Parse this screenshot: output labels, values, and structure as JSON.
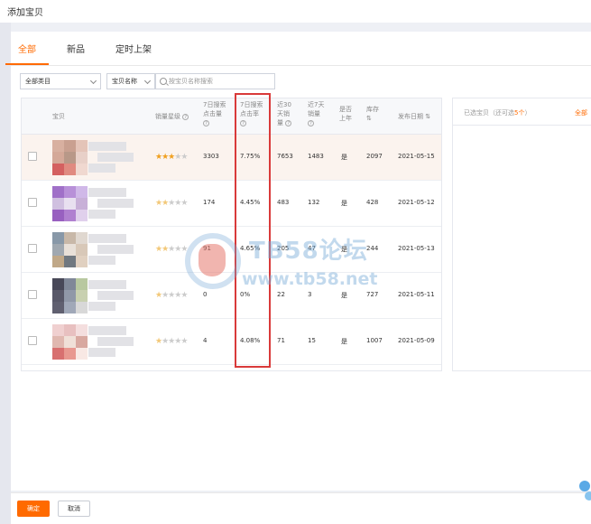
{
  "dialog": {
    "title": "添加宝贝"
  },
  "tabs": [
    {
      "label": "全部",
      "active": true
    },
    {
      "label": "新品",
      "active": false
    },
    {
      "label": "定时上架",
      "active": false
    }
  ],
  "filters": {
    "category_select": "全部类目",
    "field_select": "宝贝名称",
    "search_placeholder": "按宝贝名称搜索"
  },
  "table": {
    "headers": {
      "item": "宝贝",
      "star": "销量星级",
      "search_clicks": [
        "7日搜索",
        "点击量"
      ],
      "ctr": [
        "7日搜索",
        "点击率"
      ],
      "sales30": [
        "近30",
        "天销",
        "量"
      ],
      "sales7": [
        "近7天",
        "销量"
      ],
      "listed": [
        "是否",
        "上年"
      ],
      "stock": [
        "库存"
      ],
      "date": "发布日期"
    },
    "rows": [
      {
        "stars": 3,
        "search_clicks": "3303",
        "ctr": "7.75%",
        "sales30": "7653",
        "sales7": "1483",
        "listed": "是",
        "stock": "2097",
        "date": "2021-05-15",
        "highlight": true,
        "thumb": [
          "#d8b0a0",
          "#c9a090",
          "#e4c4b8",
          "#d4a898",
          "#b89888",
          "#e8d0c8",
          "#d46060",
          "#e08a80",
          "#f0d8d0"
        ]
      },
      {
        "stars": 2,
        "search_clicks": "174",
        "ctr": "4.45%",
        "sales30": "483",
        "sales7": "132",
        "listed": "是",
        "stock": "428",
        "date": "2021-05-12",
        "highlight": false,
        "thumb": [
          "#a070c8",
          "#b890d8",
          "#d0b8e8",
          "#d0c0e0",
          "#e8e0f0",
          "#c8b0d8",
          "#9860c0",
          "#b080d0",
          "#e0d0ec"
        ]
      },
      {
        "stars": 2,
        "search_clicks": "91",
        "ctr": "4.65%",
        "sales30": "205",
        "sales7": "47",
        "listed": "是",
        "stock": "244",
        "date": "2021-05-13",
        "highlight": false,
        "thumb": [
          "#8898a8",
          "#c8b8a8",
          "#e0d8d0",
          "#a0a8b0",
          "#e8e0d8",
          "#d8c8b8",
          "#c0a888",
          "#707880",
          "#e0d0c0"
        ]
      },
      {
        "stars": 1,
        "search_clicks": "0",
        "ctr": "0%",
        "sales30": "22",
        "sales7": "3",
        "listed": "是",
        "stock": "727",
        "date": "2021-05-11",
        "highlight": false,
        "thumb": [
          "#484858",
          "#808898",
          "#b8c8a0",
          "#585868",
          "#9098a8",
          "#c8d0b0",
          "#606070",
          "#a0a8b8",
          "#d8d8d8"
        ]
      },
      {
        "stars": 1,
        "search_clicks": "4",
        "ctr": "4.08%",
        "sales30": "71",
        "sales7": "15",
        "listed": "是",
        "stock": "1007",
        "date": "2021-05-09",
        "highlight": false,
        "thumb": [
          "#f0d0d0",
          "#e8c0c0",
          "#f4dede",
          "#e0b8b0",
          "#f0e0d8",
          "#d8a8a0",
          "#d87070",
          "#e89890",
          "#f8e8e4"
        ]
      },
      {
        "stars": 0,
        "search_clicks": "",
        "ctr": "",
        "sales30": "",
        "sales7": "",
        "listed": "",
        "stock": "",
        "date": "",
        "highlight": false,
        "thumb": [
          "#f0e8e8",
          "#f4eeee",
          "#f8f4f4",
          "#f4ecec",
          "#f8f2f2",
          "#fbf8f8",
          "#fbf8f8",
          "#fbf8f8",
          "#fbf8f8"
        ]
      }
    ]
  },
  "selected_panel": {
    "title_prefix": "已选宝贝（还可选",
    "title_count": "5个",
    "title_suffix": "）",
    "action": "全部"
  },
  "watermark": {
    "brand": "TB58论坛",
    "url": "www.tb58.net"
  },
  "footer": {
    "ok_label": "确定",
    "cancel_label": "取消"
  },
  "colors": {
    "accent": "#ff6a00",
    "annotation": "#d93a3a"
  }
}
